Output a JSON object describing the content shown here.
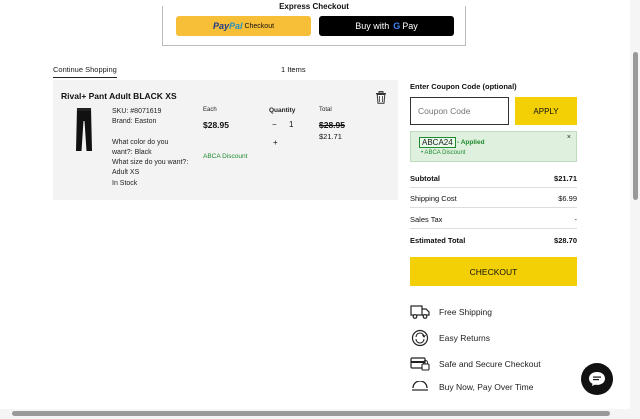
{
  "express": {
    "title": "Express Checkout",
    "paypal_logo_a": "Pay",
    "paypal_logo_b": "Pal",
    "paypal_label": "Checkout",
    "gpay_prefix": "Buy with",
    "gpay_g": "G",
    "gpay_suffix": "Pay"
  },
  "cart": {
    "continue_label": "Continue Shopping",
    "items_count": "1 Items",
    "item": {
      "title": "Rival+ Pant Adult BLACK XS",
      "sku": "SKU: #8071619",
      "brand": "Brand: Easton",
      "color_q": "What color do you",
      "color_q2": "want?: Black",
      "size_q": "What size do you want?:",
      "size_val": "Adult XS",
      "stock": "In Stock",
      "each_header": "Each",
      "qty_header": "Quantity",
      "total_header": "Total",
      "each_price": "$28.95",
      "qty_minus": "−",
      "qty": "1",
      "qty_plus": "+",
      "total_old": "$28.95",
      "total_new": "$21.71",
      "discount_label": "ABCA Discount"
    }
  },
  "coupon": {
    "heading": "Enter Coupon Code (optional)",
    "placeholder": "Coupon Code",
    "apply_label": "APPLY",
    "code": "ABCA24",
    "applied_text": "- Applied",
    "applied_sub": "•  ABCA Discount",
    "close": "×"
  },
  "summary": {
    "subtotal_label": "Subtotal",
    "subtotal_val": "$21.71",
    "shipping_label": "Shipping Cost",
    "shipping_val": "$6.99",
    "tax_label": "Sales Tax",
    "tax_val": "-",
    "total_label": "Estimated Total",
    "total_val": "$28.70",
    "checkout_label": "CHECKOUT"
  },
  "features": {
    "shipping": "Free Shipping",
    "returns": "Easy Returns",
    "secure": "Safe and Secure Checkout",
    "bnpl": "Buy Now, Pay Over Time"
  },
  "colors": {
    "accent_yellow": "#f3cf06",
    "paypal_yellow": "#f7be38",
    "discount_green": "#1f8a2e"
  }
}
